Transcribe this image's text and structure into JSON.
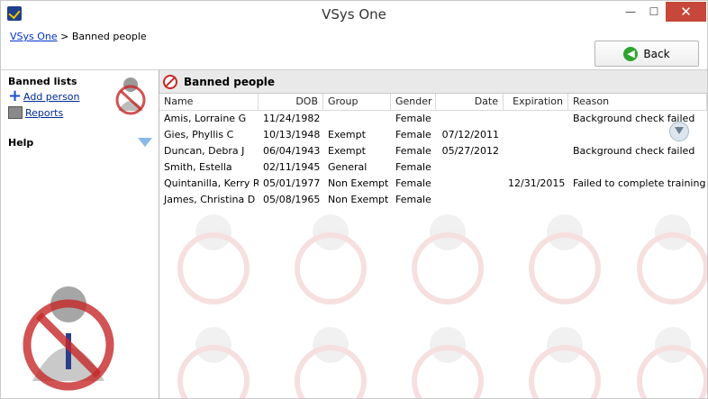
{
  "window": {
    "title": "VSys One",
    "minimize": "—",
    "maximize": "☐",
    "close": "✕"
  },
  "breadcrumb": {
    "home": "VSys One",
    "separator": ">",
    "current": "Banned people"
  },
  "toolbar": {
    "back_label": "Back"
  },
  "sidebar": {
    "section1_title": "Banned lists",
    "add_person": "Add person",
    "reports": "Reports",
    "section2_title": "Help"
  },
  "content": {
    "title": "Banned people"
  },
  "table": {
    "columns": [
      "Name",
      "DOB",
      "Group",
      "Gender",
      "Date",
      "Expiration",
      "Reason"
    ],
    "rows": [
      [
        "Amis, Lorraine G",
        "11/24/1982",
        "",
        "Female",
        "",
        "",
        "Background check failed"
      ],
      [
        "Gies, Phyllis C",
        "10/13/1948",
        "Exempt",
        "Female",
        "07/12/2011",
        "",
        ""
      ],
      [
        "Duncan, Debra J",
        "06/04/1943",
        "Exempt",
        "Female",
        "05/27/2012",
        "",
        "Background check failed"
      ],
      [
        "Smith, Estella",
        "02/11/1945",
        "General",
        "Female",
        "",
        "",
        ""
      ],
      [
        "Quintanilla, Kerry R",
        "05/01/1977",
        "Non Exempt",
        "Female",
        "",
        "12/31/2015",
        "Failed to complete training"
      ],
      [
        "James, Christina D",
        "05/08/1965",
        "Non Exempt",
        "Female",
        "",
        "",
        ""
      ]
    ]
  },
  "colors": {
    "close_button": "#c7473a",
    "link": "#0033cc",
    "banned_red": "#c62828",
    "header_bg": "#e9e9e9"
  }
}
